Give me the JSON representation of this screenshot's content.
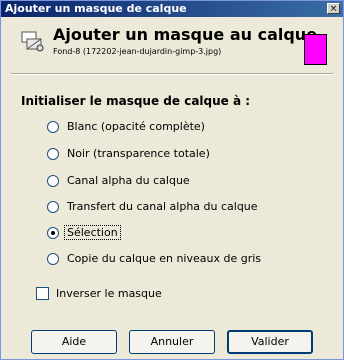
{
  "window": {
    "title": "Ajouter un masque de calque",
    "close_glyph": "×"
  },
  "header": {
    "icon": "layer-mask-icon",
    "title": "Ajouter un masque au calque",
    "subtitle": "Fond-8 (172202-jean-dujardin-gimp-3.jpg)",
    "swatch_color": "#ff00ff"
  },
  "section": {
    "label": "Initialiser le masque de calque à :"
  },
  "options": [
    {
      "label": "Blanc (opacité complète)",
      "selected": false
    },
    {
      "label": "Noir (transparence totale)",
      "selected": false
    },
    {
      "label": "Canal alpha du calque",
      "selected": false
    },
    {
      "label": "Transfert du canal alpha du calque",
      "selected": false
    },
    {
      "label": "Sélection",
      "selected": true
    },
    {
      "label": "Copie du calque en niveaux de gris",
      "selected": false
    }
  ],
  "invert": {
    "label": "Inverser le masque",
    "checked": false
  },
  "buttons": {
    "help": "Aide",
    "cancel": "Annuler",
    "ok": "Valider"
  }
}
